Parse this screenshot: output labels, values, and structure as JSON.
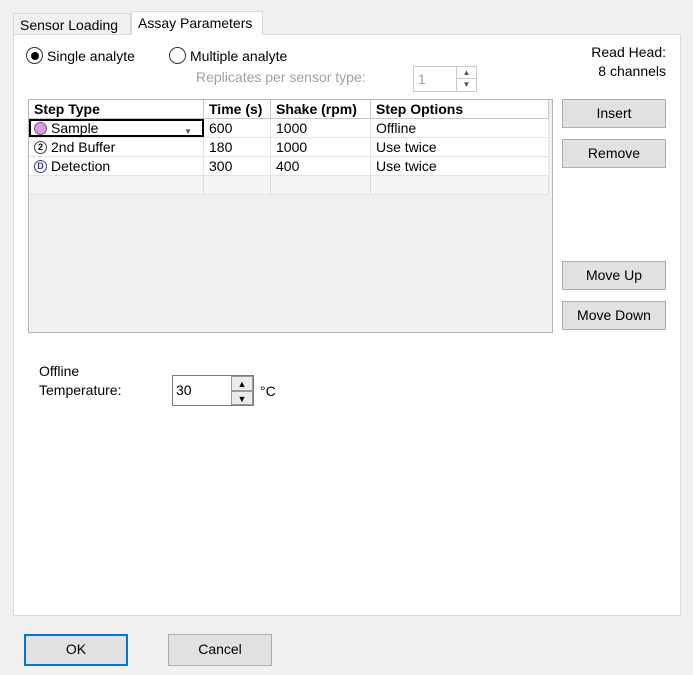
{
  "tabs": [
    {
      "label": "Sensor Loading"
    },
    {
      "label": "Assay Parameters"
    }
  ],
  "analyte": {
    "single_label": "Single analyte",
    "multiple_label": "Multiple analyte",
    "selected": "single"
  },
  "replicates": {
    "label": "Replicates per sensor type:",
    "value": "1"
  },
  "read_head": {
    "line1": "Read Head:",
    "line2": "8 channels"
  },
  "grid": {
    "headers": [
      "Step Type",
      "Time (s)",
      "Shake (rpm)",
      "Step Options"
    ],
    "rows": [
      {
        "icon": "sample-circle-icon",
        "step": "Sample",
        "time": "600",
        "shake": "1000",
        "options": "Offline"
      },
      {
        "icon": "buffer-2-icon",
        "icon_glyph": "2",
        "step": "2nd Buffer",
        "time": "180",
        "shake": "1000",
        "options": "Use twice"
      },
      {
        "icon": "detection-d-icon",
        "icon_glyph": "D",
        "step": "Detection",
        "time": "300",
        "shake": "400",
        "options": "Use twice"
      }
    ]
  },
  "buttons": {
    "insert": "Insert",
    "remove": "Remove",
    "move_up": "Move Up",
    "move_down": "Move Down",
    "ok": "OK",
    "cancel": "Cancel"
  },
  "temperature": {
    "label_line1": "Offline",
    "label_line2": "Temperature:",
    "value": "30",
    "unit": "°C"
  },
  "colors": {
    "sample_icon": "#d89ee0",
    "ok_border": "#0078d7"
  }
}
